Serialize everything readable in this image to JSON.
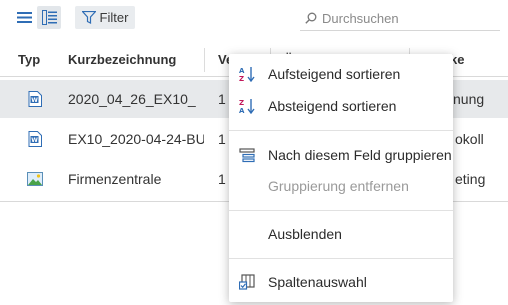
{
  "toolbar": {
    "list_view_icon": "list-icon",
    "detail_view_icon": "detail-list-icon",
    "filter_label": "Filter",
    "search_placeholder": "Durchsuchen"
  },
  "table": {
    "headers": {
      "typ": "Typ",
      "kurzbezeichnung": "Kurzbezeichnung",
      "col3": "Ve",
      "col4": "Ü",
      "col5": "ke"
    },
    "rows": [
      {
        "icon": "word-document-icon",
        "name": "2020_04_26_EX10_",
        "col3": "1",
        "col5": "nung",
        "selected": true
      },
      {
        "icon": "word-document-icon",
        "name": "EX10_2020-04-24-BU",
        "col3": "1",
        "col5": "okoll",
        "selected": false
      },
      {
        "icon": "image-file-icon",
        "name": "Firmenzentrale",
        "col3": "1",
        "col5": "eting",
        "selected": false
      }
    ]
  },
  "menu": {
    "sort_asc": "Aufsteigend sortieren",
    "sort_desc": "Absteigend sortieren",
    "group_by": "Nach diesem Feld gruppieren",
    "remove_grouping": "Gruppierung entfernen",
    "hide": "Ausblenden",
    "column_select": "Spaltenauswahl"
  },
  "colors": {
    "accent_blue": "#2f6db5",
    "selected_row": "#e7e9eb",
    "disabled_text": "#9a9a9a"
  }
}
